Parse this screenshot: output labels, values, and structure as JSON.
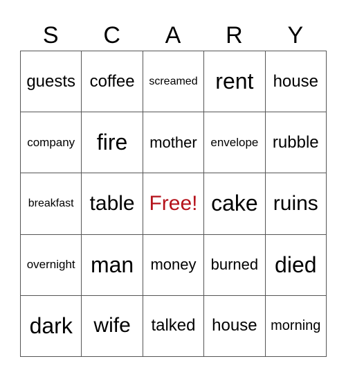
{
  "header": [
    "S",
    "C",
    "A",
    "R",
    "Y"
  ],
  "free_color": "#b5121b",
  "rows": [
    [
      "guests",
      "coffee",
      "screamed",
      "rent",
      "house"
    ],
    [
      "company",
      "fire",
      "mother",
      "envelope",
      "rubble"
    ],
    [
      "breakfast",
      "table",
      "Free!",
      "cake",
      "ruins"
    ],
    [
      "overnight",
      "man",
      "money",
      "burned",
      "died"
    ],
    [
      "dark",
      "wife",
      "talked",
      "house",
      "morning"
    ]
  ]
}
